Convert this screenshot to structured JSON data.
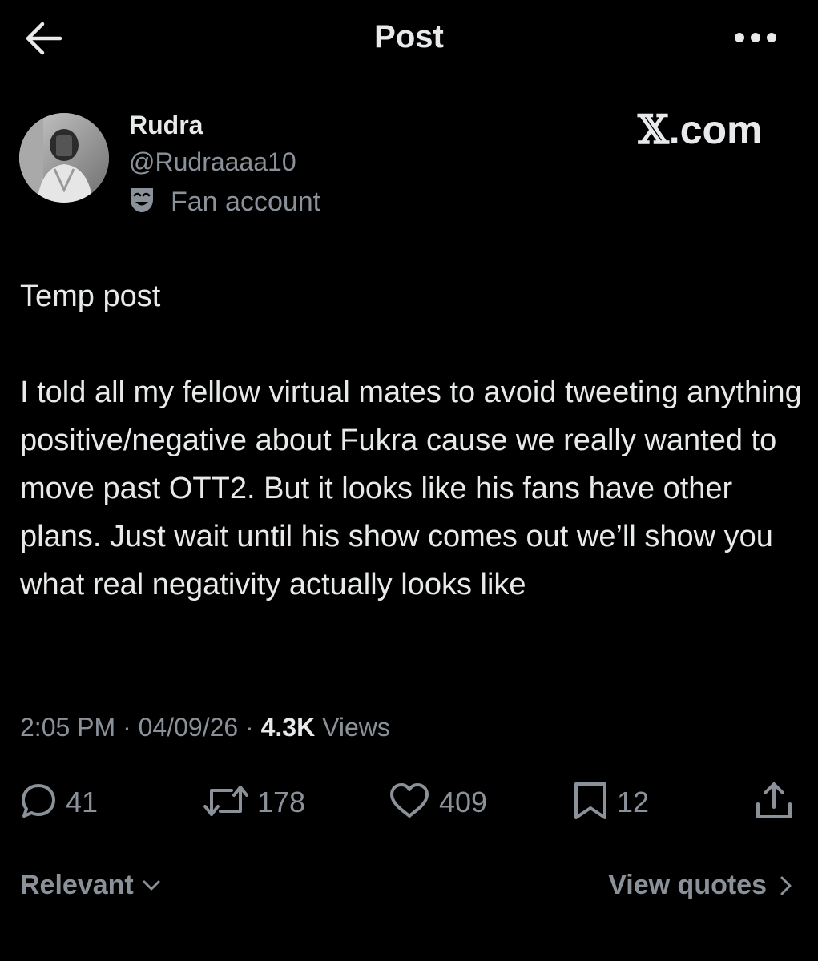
{
  "header": {
    "title": "Post",
    "back_icon": "arrow-left-icon",
    "more_icon": "more-horizontal-icon"
  },
  "author": {
    "display_name": "Rudra",
    "handle": "@Rudraaaa10",
    "label_icon": "theater-mask-icon",
    "label": "Fan account"
  },
  "watermark": {
    "x": "𝕏",
    "domain": ".com"
  },
  "post": {
    "paragraphs": [
      "Temp post",
      "I told all my fellow virtual mates to avoid tweeting anything positive/negative about Fukra cause we really wanted to move past OTT2. But it looks like his fans have other plans. Just wait until his show comes out we’ll show you what real negativity actually looks like"
    ]
  },
  "meta": {
    "time": "2:05 PM",
    "separator": " · ",
    "date": "04/09/26",
    "views_count": "4.3K",
    "views_label": " Views"
  },
  "actions": {
    "replies": "41",
    "reposts": "178",
    "likes": "409",
    "bookmarks": "12"
  },
  "footer": {
    "sort_label": "Relevant",
    "quotes_label": "View quotes"
  },
  "colors": {
    "background": "#000000",
    "text_primary": "#e7e9ea",
    "text_secondary": "#8b9199"
  }
}
